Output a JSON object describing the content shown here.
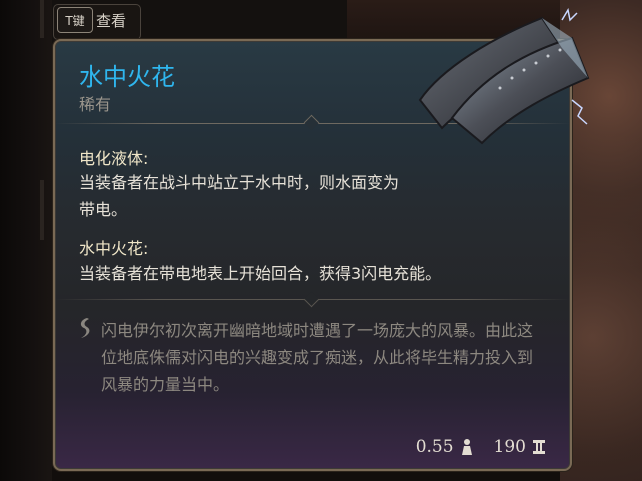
{
  "hint": {
    "key": "T键",
    "label": "查看"
  },
  "item": {
    "name": "水中火花",
    "rarity": "稀有",
    "properties": [
      {
        "name": "电化液体:",
        "description": "当装备者在战斗中站立于水中时，则水面变为带电。"
      },
      {
        "name": "水中火花:",
        "description": "当装备者在带电地表上开始回合，获得3闪电充能。"
      }
    ],
    "lore": "闪电伊尔初次离开幽暗地域时遭遇了一场庞大的风暴。由此这位地底侏儒对闪电的兴趣变成了痴迷，从此将毕生精力投入到风暴的力量当中。",
    "weight": "0.55",
    "value": "190"
  },
  "colors": {
    "title": "#2fb6ee",
    "border": "#7a6a55"
  },
  "icons": {
    "lore": "quote-icon",
    "weight": "weight-icon",
    "value": "gold-icon"
  }
}
